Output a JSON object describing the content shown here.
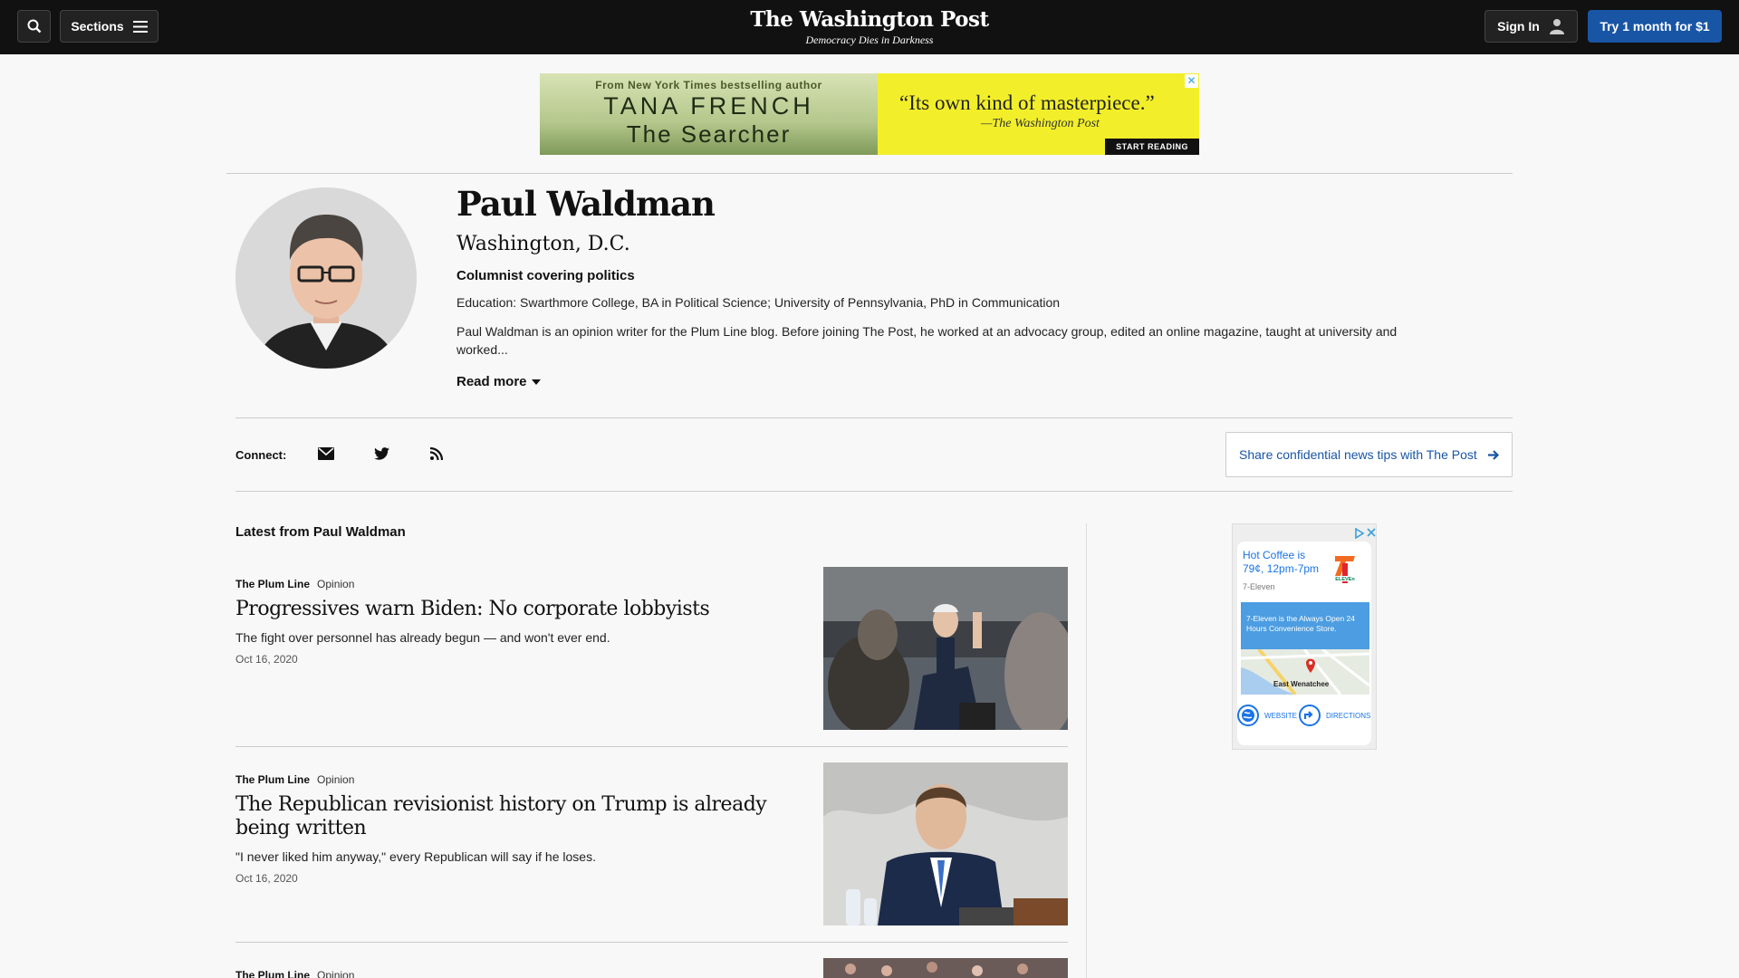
{
  "header": {
    "sections_label": "Sections",
    "logo": "The Washington Post",
    "tagline": "Democracy Dies in Darkness",
    "signin_label": "Sign In",
    "trial_label": "Try 1 month for $1"
  },
  "ad_banner": {
    "from_text": "From New York Times bestselling author",
    "author": "TANA FRENCH",
    "book": "The Searcher",
    "quote": "“Its own kind of masterpiece.”",
    "source": "—The Washington Post",
    "cta": "START READING"
  },
  "author": {
    "name": "Paul Waldman",
    "location": "Washington, D.C.",
    "role": "Columnist covering politics",
    "education": "Education: Swarthmore College, BA in Political Science; University of Pennsylvania, PhD in Communication",
    "bio": "Paul Waldman is an opinion writer for the Plum Line blog. Before joining The Post, he worked at an advocacy group, edited an online magazine, taught at university and worked...",
    "read_more": "Read more"
  },
  "connect": {
    "label": "Connect:",
    "icons": [
      "email-icon",
      "twitter-icon",
      "rss-icon"
    ],
    "tips_label": "Share confidential news tips with The Post"
  },
  "latest": {
    "title": "Latest from Paul Waldman",
    "articles": [
      {
        "section": "The Plum Line",
        "label": "Opinion",
        "headline": "Progressives warn Biden: No corporate lobbyists",
        "blurb": "The fight over personnel has already begun — and won't ever end.",
        "date": "Oct 16, 2020"
      },
      {
        "section": "The Plum Line",
        "label": "Opinion",
        "headline": "The Republican revisionist history on Trump is already being written",
        "blurb": "\"I never liked him anyway,\" every Republican will say if he loses.",
        "date": "Oct 16, 2020"
      },
      {
        "section": "The Plum Line",
        "label": "Opinion"
      }
    ]
  },
  "side_ad": {
    "title": "Hot Coffee is 79¢, 12pm-7pm",
    "brand": "7-Eleven",
    "info": "7-Eleven is the Always Open 24 Hours Convenience Store.",
    "map_label": "East Wenatchee",
    "website_label": "WEBSITE",
    "directions_label": "DIRECTIONS"
  },
  "colors": {
    "header_bg": "#111111",
    "accent_blue": "#1955a5",
    "page_bg": "#f8f8f8"
  }
}
